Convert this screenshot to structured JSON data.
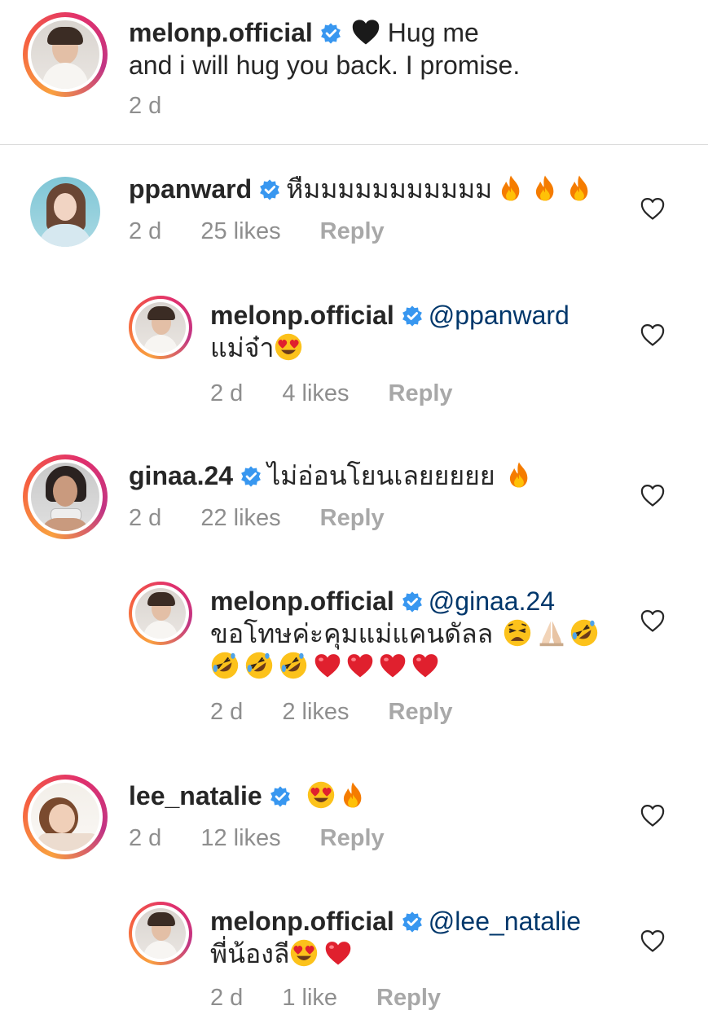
{
  "caption": {
    "username": "melonp.official",
    "text_line1": "Hug me",
    "text_line2": "and i will hug you back. I promise.",
    "emoji": "black-heart",
    "time": "2 d"
  },
  "comments": [
    {
      "username": "ppanward",
      "text": "หืมมมมมมมมมมม",
      "emojis": [
        "fire",
        "fire",
        "fire"
      ],
      "time": "2 d",
      "likes": "25 likes",
      "reply": "Reply",
      "is_reply": false
    },
    {
      "username": "melonp.official",
      "mention": "@ppanward",
      "text": "แม่จ๋า",
      "emojis": [
        "heart-eyes"
      ],
      "time": "2 d",
      "likes": "4 likes",
      "reply": "Reply",
      "is_reply": true
    },
    {
      "username": "ginaa.24",
      "text": "ไม่อ่อนโยนเลยยยยย",
      "emojis": [
        "fire"
      ],
      "time": "2 d",
      "likes": "22 likes",
      "reply": "Reply",
      "is_reply": false
    },
    {
      "username": "melonp.official",
      "mention": "@ginaa.24",
      "text": "ขอโทษค่ะคุมแม่แคนดัลล",
      "emojis": [
        "weary",
        "pray",
        "rofl",
        "rofl",
        "rofl",
        "rofl",
        "red-heart",
        "red-heart",
        "red-heart",
        "red-heart"
      ],
      "time": "2 d",
      "likes": "2 likes",
      "reply": "Reply",
      "is_reply": true
    },
    {
      "username": "lee_natalie",
      "text": "",
      "emojis": [
        "heart-eyes",
        "fire"
      ],
      "time": "2 d",
      "likes": "12 likes",
      "reply": "Reply",
      "is_reply": false
    },
    {
      "username": "melonp.official",
      "mention": "@lee_natalie",
      "text": "พี่น้องลี",
      "emojis": [
        "heart-eyes",
        "red-heart"
      ],
      "time": "2 d",
      "likes": "1 like",
      "reply": "Reply",
      "is_reply": true
    }
  ],
  "colors": {
    "text": "#262626",
    "meta": "#8e8e8e",
    "mention": "#00376b",
    "verified": "#3897f0",
    "divider": "#dbdbdb"
  }
}
